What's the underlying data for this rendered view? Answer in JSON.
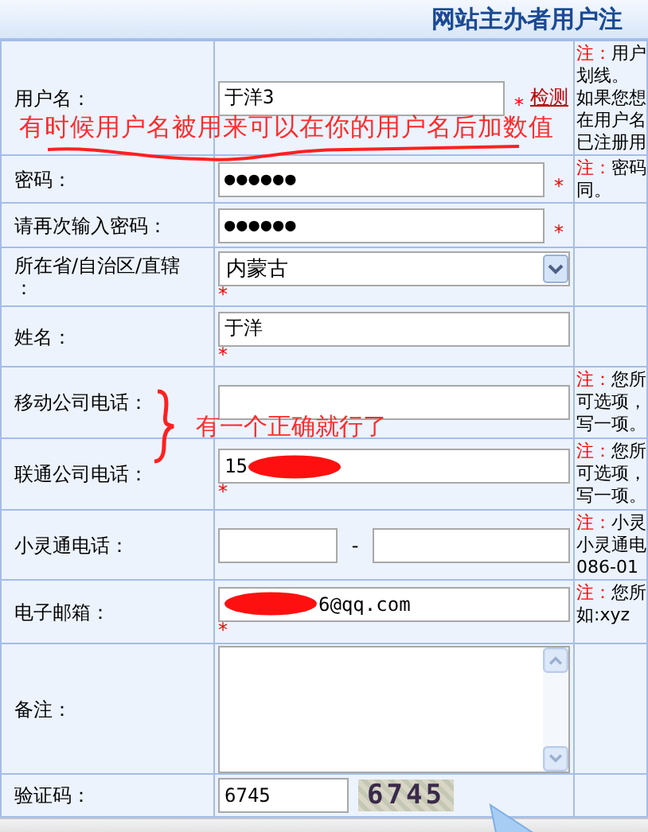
{
  "title": "网站主办者用户注",
  "rows": [
    {
      "kind": "text",
      "label": [
        "用户名："
      ],
      "value": "于洋3",
      "required_mark": "*",
      "link": "检测",
      "note": {
        "mark": "注：",
        "lines": [
          "用户",
          "划线。",
          "如果您想",
          "在用户名",
          "已注册用"
        ]
      }
    },
    {
      "kind": "password",
      "label": [
        "密码："
      ],
      "value": "●●●●●●",
      "required_mark": "*",
      "note": {
        "mark": "注：",
        "lines": [
          "密码",
          "同。"
        ]
      }
    },
    {
      "kind": "password",
      "label": [
        "请再次输入密码："
      ],
      "value": "●●●●●●",
      "required_mark": "*"
    },
    {
      "kind": "select",
      "label": [
        "所在省/自治区/直辖",
        "："
      ],
      "value": "内蒙古",
      "required_mark": "*"
    },
    {
      "kind": "text",
      "label": [
        "姓名："
      ],
      "value": "于洋",
      "required_mark": "*"
    },
    {
      "kind": "text",
      "label": [
        "移动公司电话："
      ],
      "note": {
        "mark": "注：",
        "lines": [
          "您所",
          "可选项，",
          "写一项。"
        ]
      }
    },
    {
      "kind": "text",
      "label": [
        "联通公司电话："
      ],
      "value_parts": [
        {
          "kind": "text",
          "text": "15"
        },
        {
          "kind": "redaction"
        }
      ],
      "required_mark": "*",
      "note": {
        "mark": "注：",
        "lines": [
          "您所",
          "可选项，",
          "写一项。"
        ]
      }
    },
    {
      "kind": "phone_pair",
      "label": [
        "小灵通电话："
      ],
      "separator": "-",
      "note": {
        "mark": "注：",
        "lines": [
          "小灵",
          "小灵通电",
          "086-01"
        ]
      }
    },
    {
      "kind": "text",
      "label": [
        "电子邮箱："
      ],
      "value_parts": [
        {
          "kind": "redaction"
        },
        {
          "kind": "text",
          "text": "6@qq.com"
        }
      ],
      "required_mark": "*",
      "note": {
        "mark": "注：",
        "lines": [
          "您所",
          "如:xyz"
        ]
      }
    },
    {
      "kind": "textarea",
      "label": [
        "备注："
      ]
    },
    {
      "kind": "captcha",
      "label": [
        "验证码："
      ],
      "value": "6745",
      "captcha": "6745"
    }
  ],
  "annotations": [
    {
      "kind": "underlined",
      "text": "有时候用户名被用来可以在你的用户名后加数值"
    },
    {
      "kind": "braced",
      "text": "有一个正确就行了"
    }
  ]
}
